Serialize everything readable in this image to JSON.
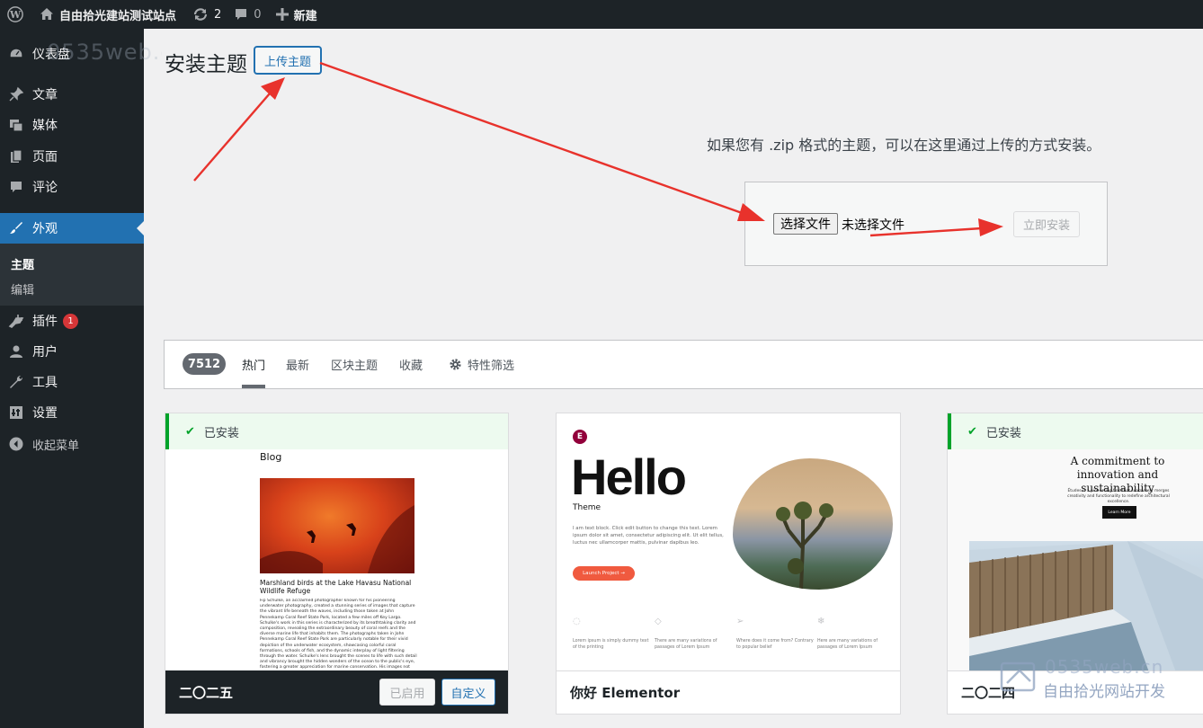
{
  "adminbar": {
    "site_name": "自由拾光建站测试站点",
    "updates_count": "2",
    "comments_count": "0",
    "new_label": "新建"
  },
  "sidebar": {
    "dashboard": "仪表盘",
    "posts": "文章",
    "media": "媒体",
    "pages": "页面",
    "comments": "评论",
    "appearance": "外观",
    "sub_themes": "主题",
    "sub_editor": "编辑",
    "plugins": "插件",
    "plugins_badge": "1",
    "users": "用户",
    "tools": "工具",
    "settings": "设置",
    "collapse": "收起菜单"
  },
  "main": {
    "title": "安装主题",
    "upload_button": "上传主题",
    "upload_help": "如果您有 .zip 格式的主题，可以在这里通过上传的方式安装。",
    "choose_file": "选择文件",
    "no_file": "未选择文件",
    "install_now": "立即安装"
  },
  "filter": {
    "count": "7512",
    "tabs": [
      "热门",
      "最新",
      "区块主题",
      "收藏"
    ],
    "feature_filter": "特性筛选"
  },
  "themes": [
    {
      "name": "二〇二五",
      "installed_label": "已安装",
      "activated_label": "已启用",
      "customize_label": "自定义",
      "preview": {
        "heading": "Blog",
        "caption": "Marshland birds at the Lake Havasu National Wildlife Refuge",
        "body": "Fip Schulke, an acclaimed photographer known for his pioneering underwater photography, created a stunning series of images that capture the vibrant life beneath the waves, including those taken at John Pennekamp Coral Reef State Park, located a few miles off Key Largo. Schulke's work in this series is characterized by its breathtaking clarity and composition, revealing the extraordinary beauty of coral reefs and the diverse marine life that inhabits them. The photographs taken in John Pennekamp Coral Reef State Park are particularly notable for their vivid depiction of the underwater ecosystem, showcasing colorful coral formations, schools of fish, and the dynamic interplay of light filtering through the water. Schulke's lens brought the scenes to life with such detail and vibrancy brought the hidden wonders of the ocean to the public's eye, fostering a greater appreciation for marine conservation. His images not only highlight the aesthetic beauty of underwater environments but"
      }
    },
    {
      "name": "你好 Elementor",
      "preview": {
        "logo": "E",
        "headline": "Hello",
        "subhead": "Theme",
        "body": "I am text block. Click edit button to change this text. Lorem ipsum dolor sit amet, consectetur adipiscing elit. Ut elit tellus, luctus nec ullamcorper mattis, pulvinar dapibus leo.",
        "cta": "Launch Project →",
        "features": [
          "Lorem ipsum is simply dummy text of the printing",
          "There are many variations of passages of Lorem Ipsum",
          "Where does it come from? Contrary to popular belief",
          "Here are many variations of passages of Lorem Ipsum"
        ]
      }
    },
    {
      "name": "二〇二四",
      "installed_label": "已安装",
      "preview": {
        "headline": "A commitment to innovation and sustainability",
        "body": "Études is a pioneering firm that seamlessly merges creativity and functionality to redefine architectural excellence.",
        "cta": "Learn More"
      }
    }
  ],
  "watermarks": {
    "top": "0535web.cn",
    "bottom_url": "0535web.cn",
    "bottom_text": "自由拾光网站开发"
  },
  "colors": {
    "admin_dark": "#1d2327",
    "accent": "#2271b1",
    "arrow": "#e8322c",
    "installed_green": "#00a32a"
  }
}
